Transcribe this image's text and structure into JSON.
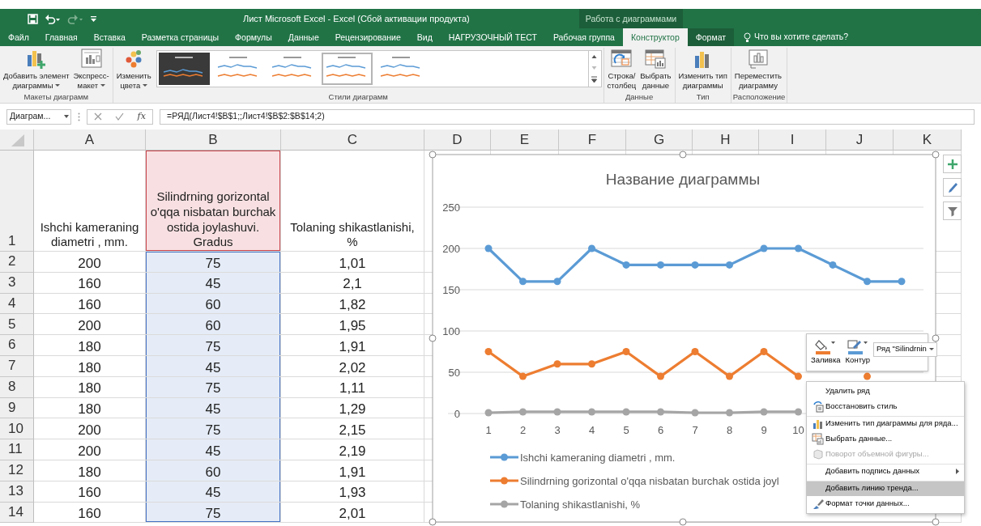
{
  "window": {
    "title": "Лист Microsoft Excel - Excel (Сбой активации продукта)"
  },
  "contextual_tab_group": "Работа с диаграммами",
  "tabs": [
    {
      "label": "Файл",
      "selected": false,
      "contextual": false
    },
    {
      "label": "Главная",
      "selected": false,
      "contextual": false
    },
    {
      "label": "Вставка",
      "selected": false,
      "contextual": false
    },
    {
      "label": "Разметка страницы",
      "selected": false,
      "contextual": false
    },
    {
      "label": "Формулы",
      "selected": false,
      "contextual": false
    },
    {
      "label": "Данные",
      "selected": false,
      "contextual": false
    },
    {
      "label": "Рецензирование",
      "selected": false,
      "contextual": false
    },
    {
      "label": "Вид",
      "selected": false,
      "contextual": false
    },
    {
      "label": "НАГРУЗОЧНЫЙ ТЕСТ",
      "selected": false,
      "contextual": false
    },
    {
      "label": "Рабочая группа",
      "selected": false,
      "contextual": false
    },
    {
      "label": "Конструктор",
      "selected": true,
      "contextual": true
    },
    {
      "label": "Формат",
      "selected": false,
      "contextual": true
    }
  ],
  "tell_me": "Что вы хотите сделать?",
  "ribbon": {
    "groups": [
      {
        "label": "Макеты диаграмм",
        "buttons": [
          {
            "lines": [
              "Добавить элемент",
              "диаграммы"
            ],
            "dropdown": true
          },
          {
            "lines": [
              "Экспресс-",
              "макет"
            ],
            "dropdown": true
          }
        ]
      },
      {
        "label": "Стили диаграмм",
        "buttons": [
          {
            "lines": [
              "Изменить",
              "цвета"
            ],
            "dropdown": true
          }
        ],
        "gallery": [
          {
            "selected": false
          },
          {
            "selected": false
          },
          {
            "selected": false
          },
          {
            "selected": true
          },
          {
            "selected": false
          }
        ]
      },
      {
        "label": "Данные",
        "buttons": [
          {
            "lines": [
              "Строка/",
              "столбец"
            ],
            "dropdown": false
          },
          {
            "lines": [
              "Выбрать",
              "данные"
            ],
            "dropdown": false
          }
        ]
      },
      {
        "label": "Тип",
        "buttons": [
          {
            "lines": [
              "Изменить тип",
              "диаграммы"
            ],
            "dropdown": false
          }
        ]
      },
      {
        "label": "Расположение",
        "buttons": [
          {
            "lines": [
              "Переместить",
              "диаграмму"
            ],
            "dropdown": false
          }
        ]
      }
    ]
  },
  "formula_bar": {
    "name_box": "Диаграм...",
    "function_button": "fx",
    "formula": "=РЯД(Лист4!$B$1;;Лист4!$B$2:$B$14;2)"
  },
  "sheet": {
    "columns": [
      "A",
      "B",
      "C",
      "D",
      "E",
      "F",
      "G",
      "H",
      "I",
      "J",
      "K"
    ],
    "rows": [
      {
        "number": "1",
        "cells": [
          {
            "text": "Ishchi kameraning diametri , mm.",
            "kind": "plain"
          },
          {
            "text": "Silindrning gorizontal o'qqa nisbatan burchak ostida joylashuvi. Gradus",
            "kind": "series-name"
          },
          {
            "text": "Tolaning shikastlanishi, %",
            "kind": "plain"
          }
        ]
      },
      {
        "number": "2",
        "cells": [
          {
            "text": "200",
            "kind": "plain"
          },
          {
            "text": "75",
            "kind": "series-values"
          },
          {
            "text": "1,01",
            "kind": "plain"
          }
        ]
      },
      {
        "number": "3",
        "cells": [
          {
            "text": "160",
            "kind": "plain"
          },
          {
            "text": "45",
            "kind": "series-values"
          },
          {
            "text": "2,1",
            "kind": "plain"
          }
        ]
      },
      {
        "number": "4",
        "cells": [
          {
            "text": "160",
            "kind": "plain"
          },
          {
            "text": "60",
            "kind": "series-values"
          },
          {
            "text": "1,82",
            "kind": "plain"
          }
        ]
      },
      {
        "number": "5",
        "cells": [
          {
            "text": "200",
            "kind": "plain"
          },
          {
            "text": "60",
            "kind": "series-values"
          },
          {
            "text": "1,95",
            "kind": "plain"
          }
        ]
      },
      {
        "number": "6",
        "cells": [
          {
            "text": "180",
            "kind": "plain"
          },
          {
            "text": "75",
            "kind": "series-values"
          },
          {
            "text": "1,91",
            "kind": "plain"
          }
        ]
      },
      {
        "number": "7",
        "cells": [
          {
            "text": "180",
            "kind": "plain"
          },
          {
            "text": "45",
            "kind": "series-values"
          },
          {
            "text": "2,02",
            "kind": "plain"
          }
        ]
      },
      {
        "number": "8",
        "cells": [
          {
            "text": "180",
            "kind": "plain"
          },
          {
            "text": "75",
            "kind": "series-values"
          },
          {
            "text": "1,11",
            "kind": "plain"
          }
        ]
      },
      {
        "number": "9",
        "cells": [
          {
            "text": "180",
            "kind": "plain"
          },
          {
            "text": "45",
            "kind": "series-values"
          },
          {
            "text": "1,29",
            "kind": "plain"
          }
        ]
      },
      {
        "number": "10",
        "cells": [
          {
            "text": "200",
            "kind": "plain"
          },
          {
            "text": "75",
            "kind": "series-values"
          },
          {
            "text": "2,15",
            "kind": "plain"
          }
        ]
      },
      {
        "number": "11",
        "cells": [
          {
            "text": "200",
            "kind": "plain"
          },
          {
            "text": "45",
            "kind": "series-values"
          },
          {
            "text": "2,19",
            "kind": "plain"
          }
        ]
      },
      {
        "number": "12",
        "cells": [
          {
            "text": "180",
            "kind": "plain"
          },
          {
            "text": "60",
            "kind": "series-values"
          },
          {
            "text": "1,91",
            "kind": "plain"
          }
        ]
      },
      {
        "number": "13",
        "cells": [
          {
            "text": "160",
            "kind": "plain"
          },
          {
            "text": "45",
            "kind": "series-values"
          },
          {
            "text": "1,93",
            "kind": "plain"
          }
        ]
      },
      {
        "number": "14",
        "cells": [
          {
            "text": "160",
            "kind": "plain"
          },
          {
            "text": "75",
            "kind": "series-values"
          },
          {
            "text": "2,01",
            "kind": "plain"
          }
        ]
      }
    ]
  },
  "chart": {
    "selected": true,
    "chart_data": {
      "type": "line",
      "title": "Название диаграммы",
      "categories": [
        "1",
        "2",
        "3",
        "4",
        "5",
        "6",
        "7",
        "8",
        "9",
        "10",
        null,
        null,
        null
      ],
      "series": [
        {
          "name": "Ishchi kameraning diametri , mm.",
          "color": "#5b9bd5",
          "marker": true,
          "values": [
            200,
            160,
            160,
            200,
            180,
            180,
            180,
            180,
            200,
            200,
            180,
            160,
            160
          ]
        },
        {
          "name": "Silindrning gorizontal o'qqa nisbatan burchak ostida joyl",
          "color": "#ed7d31",
          "marker": true,
          "values": [
            75,
            45,
            60,
            60,
            75,
            45,
            75,
            45,
            75,
            45,
            null,
            45,
            null
          ]
        },
        {
          "name": "Tolaning shikastlanishi, %",
          "color": "#a5a5a5",
          "marker": true,
          "values": [
            1,
            2,
            2,
            2,
            2,
            2,
            1,
            1,
            2,
            2,
            null,
            null,
            null
          ]
        }
      ],
      "ylim": [
        0,
        250
      ],
      "yticks": [
        0,
        50,
        100,
        150,
        200,
        250
      ],
      "grid": true,
      "legend": "bottom"
    }
  },
  "mini_toolbar": {
    "buttons": [
      {
        "label": "Заливка",
        "kind": "fill",
        "color": "#ed7d31"
      },
      {
        "label": "Контур",
        "kind": "outline",
        "color": "#5b9bd5"
      }
    ],
    "series_dropdown": "Ряд \"Silindrnin"
  },
  "context_menu": [
    {
      "label": "Удалить ряд",
      "separator_before": false,
      "disabled": false,
      "highlighted": false,
      "submenu": false
    },
    {
      "label": "Восстановить стиль",
      "separator_before": false,
      "disabled": false,
      "highlighted": false,
      "submenu": false
    },
    {
      "label": "Изменить тип диаграммы для ряда...",
      "separator_before": true,
      "disabled": false,
      "highlighted": false,
      "submenu": false
    },
    {
      "label": "Выбрать данные...",
      "separator_before": false,
      "disabled": false,
      "highlighted": false,
      "submenu": false
    },
    {
      "label": "Поворот объемной фигуры...",
      "separator_before": false,
      "disabled": true,
      "highlighted": false,
      "submenu": false
    },
    {
      "label": "Добавить подпись данных",
      "separator_before": true,
      "disabled": false,
      "highlighted": false,
      "submenu": true
    },
    {
      "label": "Добавить линию тренда...",
      "separator_before": true,
      "disabled": false,
      "highlighted": true,
      "submenu": false
    },
    {
      "label": "Формат точки данных...",
      "separator_before": false,
      "disabled": false,
      "highlighted": false,
      "submenu": false
    }
  ]
}
